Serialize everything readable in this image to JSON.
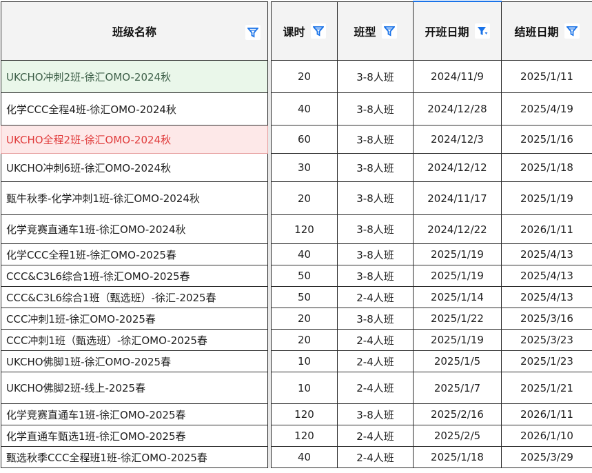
{
  "headers": {
    "name": "班级名称",
    "hours": "课时",
    "type": "班型",
    "start": "开班日期",
    "end": "结班日期"
  },
  "active_filter_column": "start",
  "rows": [
    {
      "name": "UKCHO冲刺2班-徐汇OMO-2024秋",
      "hours": "20",
      "type": "3-8人班",
      "start": "2024/11/9",
      "end": "2025/1/11",
      "state": "selected"
    },
    {
      "name": "化学CCC全程4班-徐汇OMO-2024秋",
      "hours": "40",
      "type": "3-8人班",
      "start": "2024/12/28",
      "end": "2025/4/19",
      "state": ""
    },
    {
      "name": "UKCHO全程2班-徐汇OMO-2024秋",
      "hours": "60",
      "type": "3-8人班",
      "start": "2024/12/3",
      "end": "2025/1/16",
      "state": "error"
    },
    {
      "name": "UKCHO冲刺6班-徐汇OMO-2024秋",
      "hours": "30",
      "type": "3-8人班",
      "start": "2024/12/12",
      "end": "2025/1/18",
      "state": ""
    },
    {
      "name": "甄牛秋季-化学冲刺1班-徐汇OMO-2024秋",
      "hours": "20",
      "type": "3-8人班",
      "start": "2024/11/17",
      "end": "2025/1/19",
      "state": ""
    },
    {
      "name": "化学竞赛直通车1班-徐汇OMO-2024秋",
      "hours": "120",
      "type": "3-8人班",
      "start": "2024/12/22",
      "end": "2026/1/11",
      "state": ""
    },
    {
      "name": "化学CCC全程1班-徐汇OMO-2025春",
      "hours": "40",
      "type": "3-8人班",
      "start": "2025/1/19",
      "end": "2025/4/13",
      "state": ""
    },
    {
      "name": "CCC&C3L6综合1班-徐汇OMO-2025春",
      "hours": "50",
      "type": "3-8人班",
      "start": "2025/1/19",
      "end": "2025/4/13",
      "state": ""
    },
    {
      "name": "CCC&C3L6综合1班（甄选班）-徐汇-2025春",
      "hours": "50",
      "type": "2-4人班",
      "start": "2025/1/14",
      "end": "2025/4/13",
      "state": ""
    },
    {
      "name": "CCC冲刺1班-徐汇OMO-2025春",
      "hours": "20",
      "type": "3-8人班",
      "start": "2025/1/22",
      "end": "2025/3/16",
      "state": ""
    },
    {
      "name": "CCC冲刺1班（甄选班）-徐汇OMO-2025春",
      "hours": "20",
      "type": "2-4人班",
      "start": "2025/1/19",
      "end": "2025/3/23",
      "state": ""
    },
    {
      "name": "UKCHO佛脚1班-徐汇OMO-2025春",
      "hours": "10",
      "type": "2-4人班",
      "start": "2025/1/5",
      "end": "2025/1/23",
      "state": ""
    },
    {
      "name": "UKCHO佛脚2班-线上-2025春",
      "hours": "10",
      "type": "2-4人班",
      "start": "2025/1/7",
      "end": "2025/1/21",
      "state": ""
    },
    {
      "name": "化学竞赛直通车1班-徐汇OMO-2025春",
      "hours": "120",
      "type": "3-8人班",
      "start": "2025/2/16",
      "end": "2026/1/11",
      "state": ""
    },
    {
      "name": "化学直通车甄选1班-徐汇OMO-2025春",
      "hours": "120",
      "type": "2-4人班",
      "start": "2025/2/5",
      "end": "2026/1/10",
      "state": ""
    },
    {
      "name": "甄选秋季CCC全程班1班-徐汇OMO-2025春",
      "hours": "40",
      "type": "2-4人班",
      "start": "2025/1/18",
      "end": "2025/3/29",
      "state": ""
    }
  ],
  "colors": {
    "filter_icon": "#1a73e8",
    "selected_bg": "#eaf7ea",
    "error_bg": "#fde8e8",
    "error_text": "#e03b3b"
  },
  "icons": {
    "filter": "filter-icon",
    "filter_active": "filter-sort-icon"
  }
}
